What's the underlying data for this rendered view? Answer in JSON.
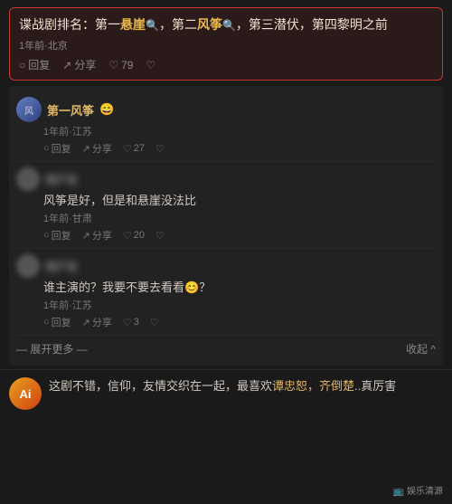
{
  "top_comment": {
    "text_parts": [
      {
        "text": "谍战剧排名：第一",
        "highlight": false
      },
      {
        "text": "悬崖",
        "highlight": true
      },
      {
        "text": "🔍，第二",
        "highlight": false
      },
      {
        "text": "风筝",
        "highlight": true
      },
      {
        "text": "🔍，第三潜伏，第四黎明之前",
        "highlight": false
      }
    ],
    "full_text": "谍战剧排名：第一悬崖🔍，第二风筝🔍，第三潜伏，第四黎明之前",
    "meta": "1年前·北京",
    "reply_label": "回复",
    "share_label": "分享",
    "like_count": "79"
  },
  "sub_comments": [
    {
      "username": "第一风筝",
      "emoji": "😄",
      "text": "",
      "meta": "1年前·江苏",
      "reply_label": "回复",
      "share_label": "分享",
      "like_count": "27"
    },
    {
      "username": "",
      "emoji": "",
      "text": "风筝是好，但是和悬崖没法比",
      "meta": "1年前·甘肃",
      "reply_label": "回复",
      "share_label": "分享",
      "like_count": "20"
    },
    {
      "username": "",
      "emoji": "",
      "text": "谁主演的？我要不要去看看😊？",
      "meta": "1年前·江苏",
      "reply_label": "回复",
      "share_label": "分享",
      "like_count": "3"
    }
  ],
  "expand_label": "— 展开更多 —",
  "collapse_label": "收起 ^",
  "bottom_comment": {
    "avatar_text": "Ai",
    "text": "这剧不错，信仰，友情交织在一起，最喜欢谭忠恕，齐倒楚..真厉害",
    "highlight_text": "谭忠恕，齐倒楚"
  },
  "source": "娱乐清源",
  "icons": {
    "reply": "○",
    "share": "↗",
    "like": "♡",
    "liked": "♥"
  }
}
